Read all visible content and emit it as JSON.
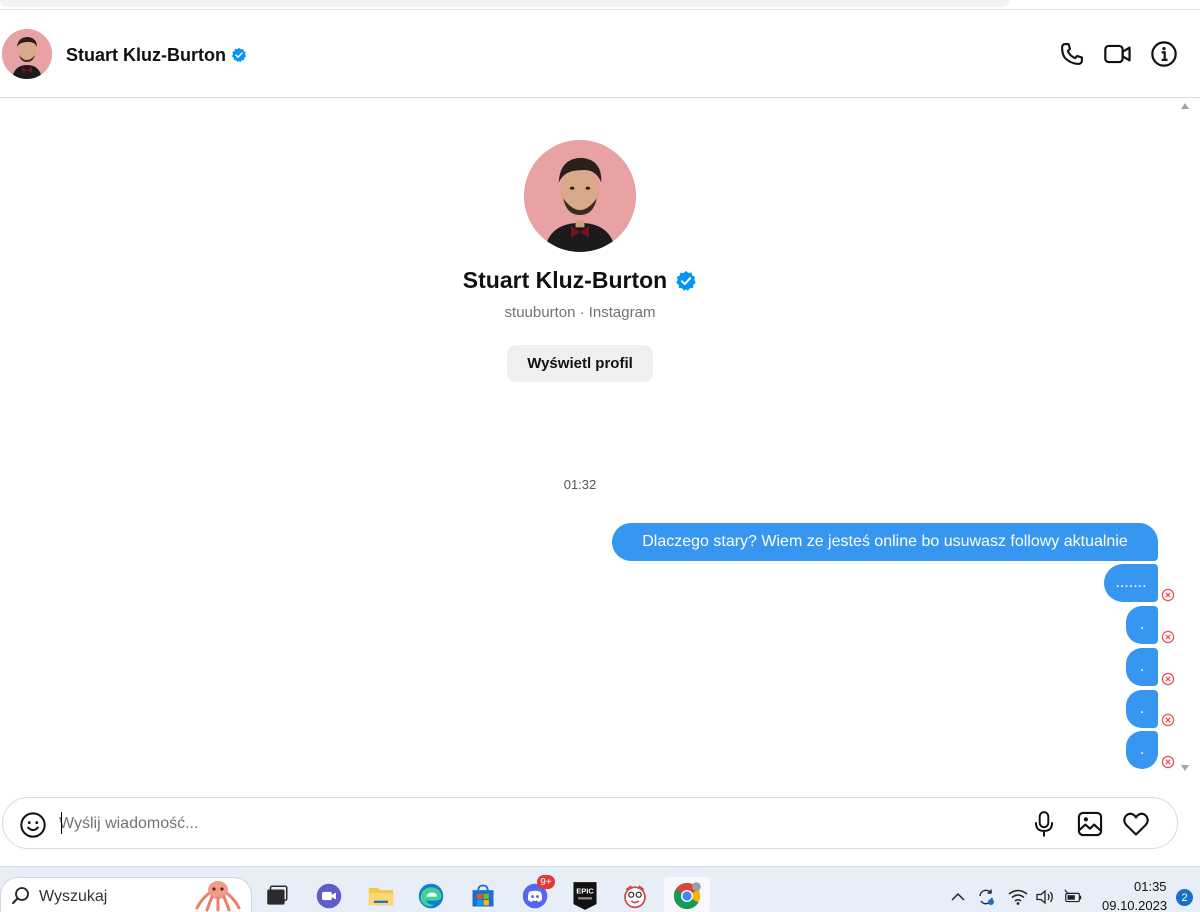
{
  "header": {
    "name": "Stuart Kluz-Burton",
    "icons": [
      "phone-icon",
      "video-camera-icon",
      "info-icon"
    ]
  },
  "profile": {
    "name": "Stuart Kluz-Burton",
    "subtitle": "stuuburton · Instagram",
    "view_button": "Wyświetl profil"
  },
  "conversation": {
    "timestamp": "01:32",
    "messages": [
      {
        "text": "Dlaczego stary? Wiem ze jesteś online bo usuwasz followy aktualnie",
        "failed": false
      },
      {
        "text": ".......",
        "failed": true
      },
      {
        "text": ".",
        "failed": true
      },
      {
        "text": ".",
        "failed": true
      },
      {
        "text": ".",
        "failed": true
      },
      {
        "text": ".",
        "failed": true
      }
    ]
  },
  "composer": {
    "placeholder": "Wyślij wiadomość...",
    "icons": [
      "emoji-icon",
      "microphone-icon",
      "image-icon",
      "heart-icon"
    ]
  },
  "taskbar": {
    "search_label": "Wyszukaj",
    "discord_badge": "9+",
    "epic_label": "EPIC",
    "time": "01:35",
    "date": "09.10.2023",
    "notifications": "2"
  },
  "colors": {
    "accent": "#3797f0",
    "verified": "#0095f6",
    "error": "#ed4956",
    "avatar_bg": "#e8a2a3"
  }
}
